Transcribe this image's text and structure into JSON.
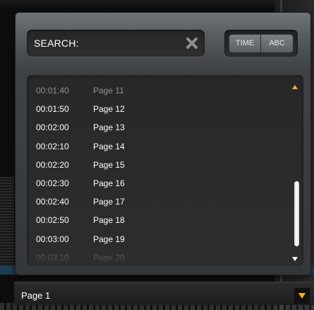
{
  "search": {
    "label": "SEARCH:",
    "clear_icon": "close-x-icon"
  },
  "sort_toggle": {
    "time_label": "TIME",
    "abc_label": "ABC"
  },
  "list": {
    "items": [
      {
        "time": "00:01:40",
        "page": "Page 11"
      },
      {
        "time": "00:01:50",
        "page": "Page 12"
      },
      {
        "time": "00:02:00",
        "page": "Page 13"
      },
      {
        "time": "00:02:10",
        "page": "Page 14"
      },
      {
        "time": "00:02:20",
        "page": "Page 15"
      },
      {
        "time": "00:02:30",
        "page": "Page 16"
      },
      {
        "time": "00:02:40",
        "page": "Page 17"
      },
      {
        "time": "00:02:50",
        "page": "Page 18"
      },
      {
        "time": "00:03:00",
        "page": "Page 19"
      },
      {
        "time": "00:03:10",
        "page": "Page 20"
      }
    ],
    "scroll_up_icon": "triangle-up-icon",
    "scroll_down_icon": "triangle-down-icon",
    "accent_color": "#f2b705"
  },
  "selector": {
    "value": "Page 1",
    "arrow_icon": "triangle-down-icon"
  }
}
